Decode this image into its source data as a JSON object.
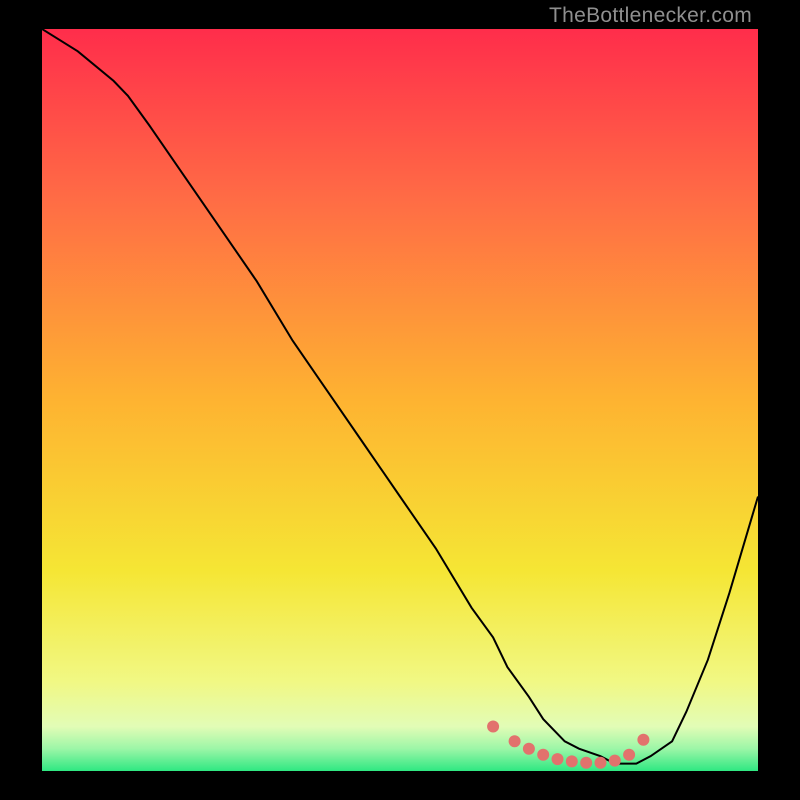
{
  "watermark": "TheBottlenecker.com",
  "chart_data": {
    "type": "line",
    "title": "",
    "xlabel": "",
    "ylabel": "",
    "xlim": [
      0,
      100
    ],
    "ylim": [
      0,
      100
    ],
    "grid": false,
    "background_gradient": {
      "stops": [
        {
          "offset": 0,
          "color": "#ff2d4b"
        },
        {
          "offset": 23,
          "color": "#ff6c45"
        },
        {
          "offset": 50,
          "color": "#feb331"
        },
        {
          "offset": 73,
          "color": "#f5e634"
        },
        {
          "offset": 88,
          "color": "#f1f884"
        },
        {
          "offset": 94,
          "color": "#e2fcb6"
        },
        {
          "offset": 97,
          "color": "#9cf6a7"
        },
        {
          "offset": 100,
          "color": "#2fe882"
        }
      ]
    },
    "series": [
      {
        "name": "curve",
        "color": "#000000",
        "x": [
          0,
          5,
          10,
          12,
          15,
          20,
          25,
          30,
          35,
          40,
          45,
          50,
          55,
          60,
          63,
          65,
          68,
          70,
          73,
          75,
          78,
          80,
          83,
          85,
          88,
          90,
          93,
          96,
          100
        ],
        "y": [
          100,
          97,
          93,
          91,
          87,
          80,
          73,
          66,
          58,
          51,
          44,
          37,
          30,
          22,
          18,
          14,
          10,
          7,
          4,
          3,
          2,
          1,
          1,
          2,
          4,
          8,
          15,
          24,
          37
        ]
      }
    ],
    "markers": {
      "name": "bottleneck-band",
      "color": "#e2726d",
      "radius_px": 6,
      "x": [
        63,
        66,
        68,
        70,
        72,
        74,
        76,
        78,
        80,
        82,
        84
      ],
      "y": [
        6,
        4,
        3,
        2.2,
        1.6,
        1.3,
        1.1,
        1.1,
        1.4,
        2.2,
        4.2
      ]
    }
  }
}
